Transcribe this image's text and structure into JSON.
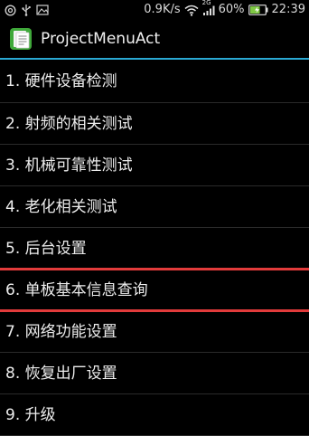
{
  "status_bar": {
    "left_icons": [
      "settings-gear-icon",
      "usb-icon",
      "image-icon"
    ],
    "network_speed": "0.9K/s",
    "network_type": "2G",
    "battery": "60%",
    "time": "22:39"
  },
  "action_bar": {
    "title": "ProjectMenuAct",
    "app_icon": "document-app-icon",
    "accent_color": "#2aa9d3"
  },
  "menu": {
    "highlight_color": "#e23b3b",
    "items": [
      {
        "label": "1. 硬件设备检测"
      },
      {
        "label": "2. 射频的相关测试"
      },
      {
        "label": "3. 机械可靠性测试"
      },
      {
        "label": "4. 老化相关测试"
      },
      {
        "label": "5. 后台设置"
      },
      {
        "label": "6. 单板基本信息查询"
      },
      {
        "label": "7. 网络功能设置"
      },
      {
        "label": "8. 恢复出厂设置"
      },
      {
        "label": "9. 升级"
      }
    ]
  }
}
